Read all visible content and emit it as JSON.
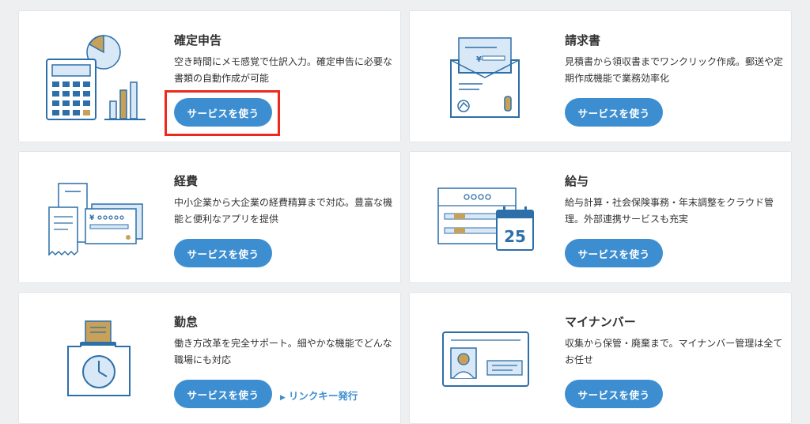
{
  "services": [
    {
      "title": "確定申告",
      "desc": "空き時間にメモ感覚で仕訳入力。確定申告に必要な書類の自動作成が可能",
      "button": "サービスを使う"
    },
    {
      "title": "請求書",
      "desc": "見積書から領収書までワンクリック作成。郵送や定期作成機能で業務効率化",
      "button": "サービスを使う",
      "yen": "¥"
    },
    {
      "title": "経費",
      "desc": "中小企業から大企業の経費精算まで対応。豊富な機能と便利なアプリを提供",
      "button": "サービスを使う",
      "yen": "¥"
    },
    {
      "title": "給与",
      "desc": "給与計算・社会保険事務・年末調整をクラウド管理。外部連携サービスも充実",
      "button": "サービスを使う",
      "calendar_day": "25"
    },
    {
      "title": "勤怠",
      "desc": "働き方改革を完全サポート。細やかな機能でどんな職場にも対応",
      "button": "サービスを使う",
      "link": "リンクキー発行"
    },
    {
      "title": "マイナンバー",
      "desc": "収集から保管・廃棄まで。マイナンバー管理は全てお任せ",
      "button": "サービスを使う"
    }
  ],
  "icons": [
    "calculator-chart-icon",
    "invoice-envelope-icon",
    "receipt-card-icon",
    "payroll-calendar-icon",
    "timecard-clock-icon",
    "mynumber-card-icon",
    "link-arrow-icon"
  ],
  "colors": {
    "accent": "#3d8ed1",
    "highlight": "#f0271b",
    "illustration_dark": "#2d6fa8",
    "illustration_light": "#d8e8f6",
    "illustration_gold": "#c7a15a"
  }
}
